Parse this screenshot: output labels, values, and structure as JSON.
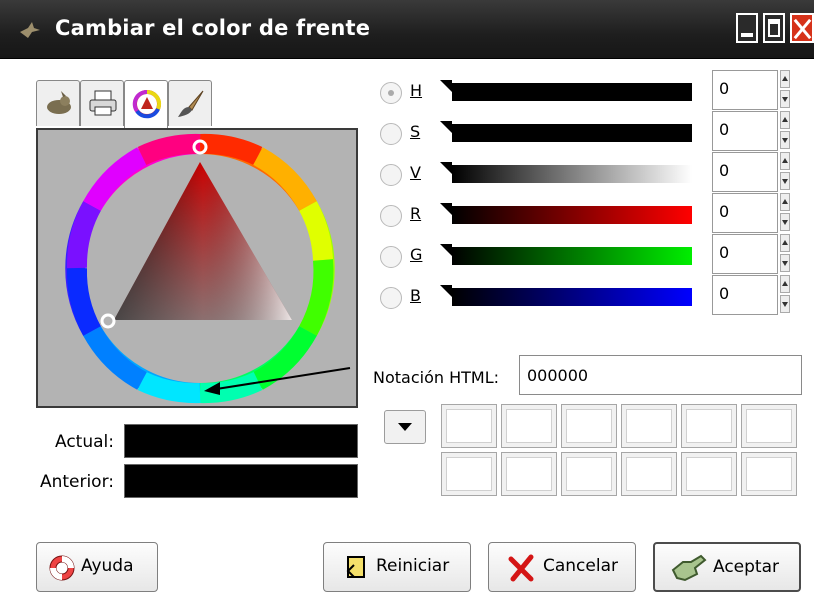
{
  "window": {
    "title": "Cambiar el color de frente"
  },
  "tabs": [
    {
      "icon": "gimp-icon"
    },
    {
      "icon": "printer-icon"
    },
    {
      "icon": "color-wheel-icon"
    },
    {
      "icon": "brush-icon"
    }
  ],
  "swatches": {
    "current_label": "Actual:",
    "previous_label": "Anterior:",
    "current_color": "#000000",
    "previous_color": "#000000"
  },
  "channels": [
    {
      "label": "H",
      "value": "0",
      "checked": true
    },
    {
      "label": "S",
      "value": "0",
      "checked": false
    },
    {
      "label": "V",
      "value": "0",
      "checked": false
    },
    {
      "label": "R",
      "value": "0",
      "checked": false
    },
    {
      "label": "G",
      "value": "0",
      "checked": false
    },
    {
      "label": "B",
      "value": "0",
      "checked": false
    }
  ],
  "html_notation": {
    "label": "Notación HTML:",
    "value": "000000"
  },
  "buttons": {
    "help": "Ayuda",
    "reset": "Reiniciar",
    "cancel": "Cancelar",
    "ok": "Aceptar"
  }
}
